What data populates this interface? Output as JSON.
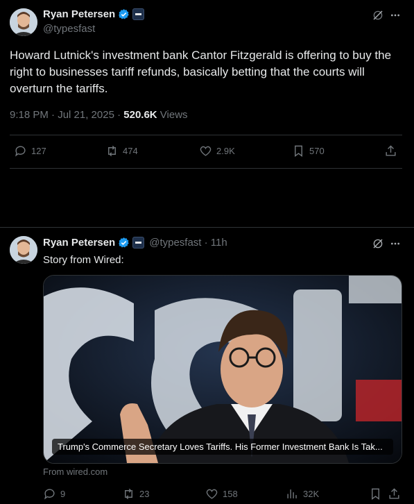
{
  "tweet1": {
    "author_name": "Ryan Petersen",
    "handle": "@typesfast",
    "text": "Howard Lutnick's investment bank Cantor Fitzgerald is offering to buy the right to businesses tariff refunds, basically betting that the courts will overturn the tariffs.",
    "timestamp": "9:18 PM · Jul 21, 2025 · ",
    "views_count": "520.6K",
    "views_label": " Views",
    "replies": "127",
    "retweets": "474",
    "likes": "2.9K",
    "bookmarks": "570"
  },
  "tweet2": {
    "author_name": "Ryan Petersen",
    "handle_time": "@typesfast · 11h",
    "text": "Story from Wired:",
    "card_caption": "Trump's Commerce Secretary Loves Tariffs. His Former Investment Bank Is Tak...",
    "card_source": "From wired.com",
    "replies": "9",
    "retweets": "23",
    "likes": "158",
    "views": "32K"
  },
  "colors": {
    "background": "#000000",
    "text": "#e7e9ea",
    "muted": "#71767b",
    "verified_blue": "#1d9bf0",
    "divider": "#2f3336"
  },
  "icons": [
    "verified-icon",
    "grok-icon",
    "more-icon",
    "reply-icon",
    "retweet-icon",
    "like-icon",
    "bookmark-icon",
    "share-icon",
    "views-icon"
  ]
}
